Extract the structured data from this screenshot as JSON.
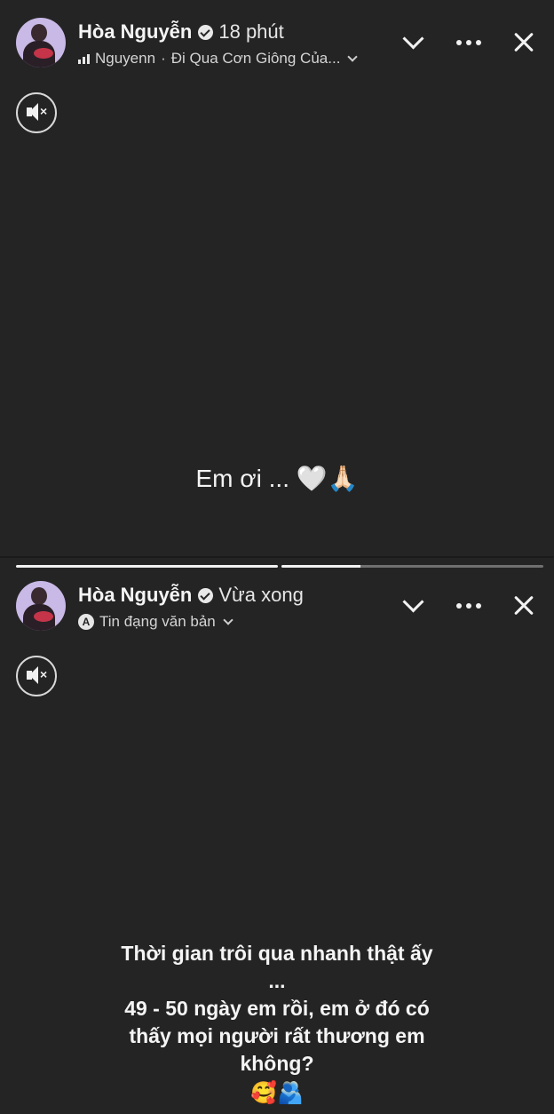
{
  "story1": {
    "user": {
      "name": "Hòa Nguyễn",
      "time": "18 phút"
    },
    "subline": {
      "music_artist": "Nguyenn",
      "separator": "·",
      "song": "Đi Qua Cơn Giông Của..."
    },
    "icons": [
      "chevron-down-icon",
      "more-icon",
      "close-icon",
      "mute-icon",
      "verified-icon"
    ],
    "caption": "Em ơi ... 🤍🙏🏻"
  },
  "story2": {
    "progress": [
      1.0,
      0.3
    ],
    "user": {
      "name": "Hòa Nguyễn",
      "time": "Vừa xong"
    },
    "subline": {
      "label": "Tin đạng văn bản"
    },
    "icons": [
      "chevron-down-icon",
      "more-icon",
      "close-icon",
      "mute-icon",
      "verified-icon",
      "text-font-icon"
    ],
    "caption": {
      "line1": "Thời gian trôi qua nhanh thật ấy",
      "line2": "...",
      "line3": "49 - 50 ngày em rồi, em ở đó có",
      "line4": "thấy mọi người rất thương em",
      "line5": "không?",
      "emojis": "🥰🫂"
    }
  }
}
